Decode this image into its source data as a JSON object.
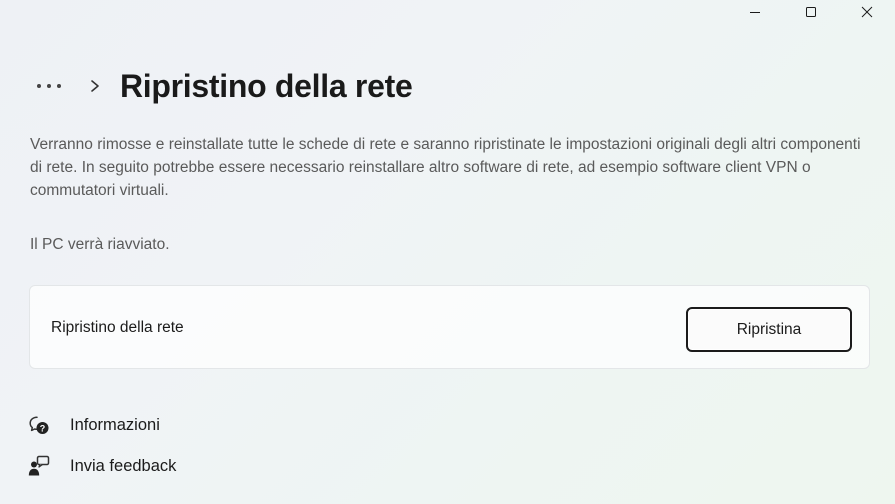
{
  "window": {
    "minimize_icon": "minimize-icon",
    "maximize_icon": "maximize-icon",
    "close_icon": "close-icon"
  },
  "header": {
    "more_icon": "more-horizontal-icon",
    "chevron_icon": "chevron-right-icon",
    "title": "Ripristino della rete"
  },
  "content": {
    "description": "Verranno rimosse e reinstallate tutte le schede di rete e saranno ripristinate le impostazioni originali degli altri componenti di rete. In seguito potrebbe essere necessario reinstallare altro software di rete, ad esempio software client VPN o commutatori virtuali.",
    "restart_note": "Il PC verrà riavviato."
  },
  "reset_card": {
    "label": "Ripristino della rete",
    "button_label": "Ripristina"
  },
  "links": [
    {
      "label": "Informazioni",
      "icon": "help-chat-icon"
    },
    {
      "label": "Invia feedback",
      "icon": "feedback-icon"
    }
  ]
}
